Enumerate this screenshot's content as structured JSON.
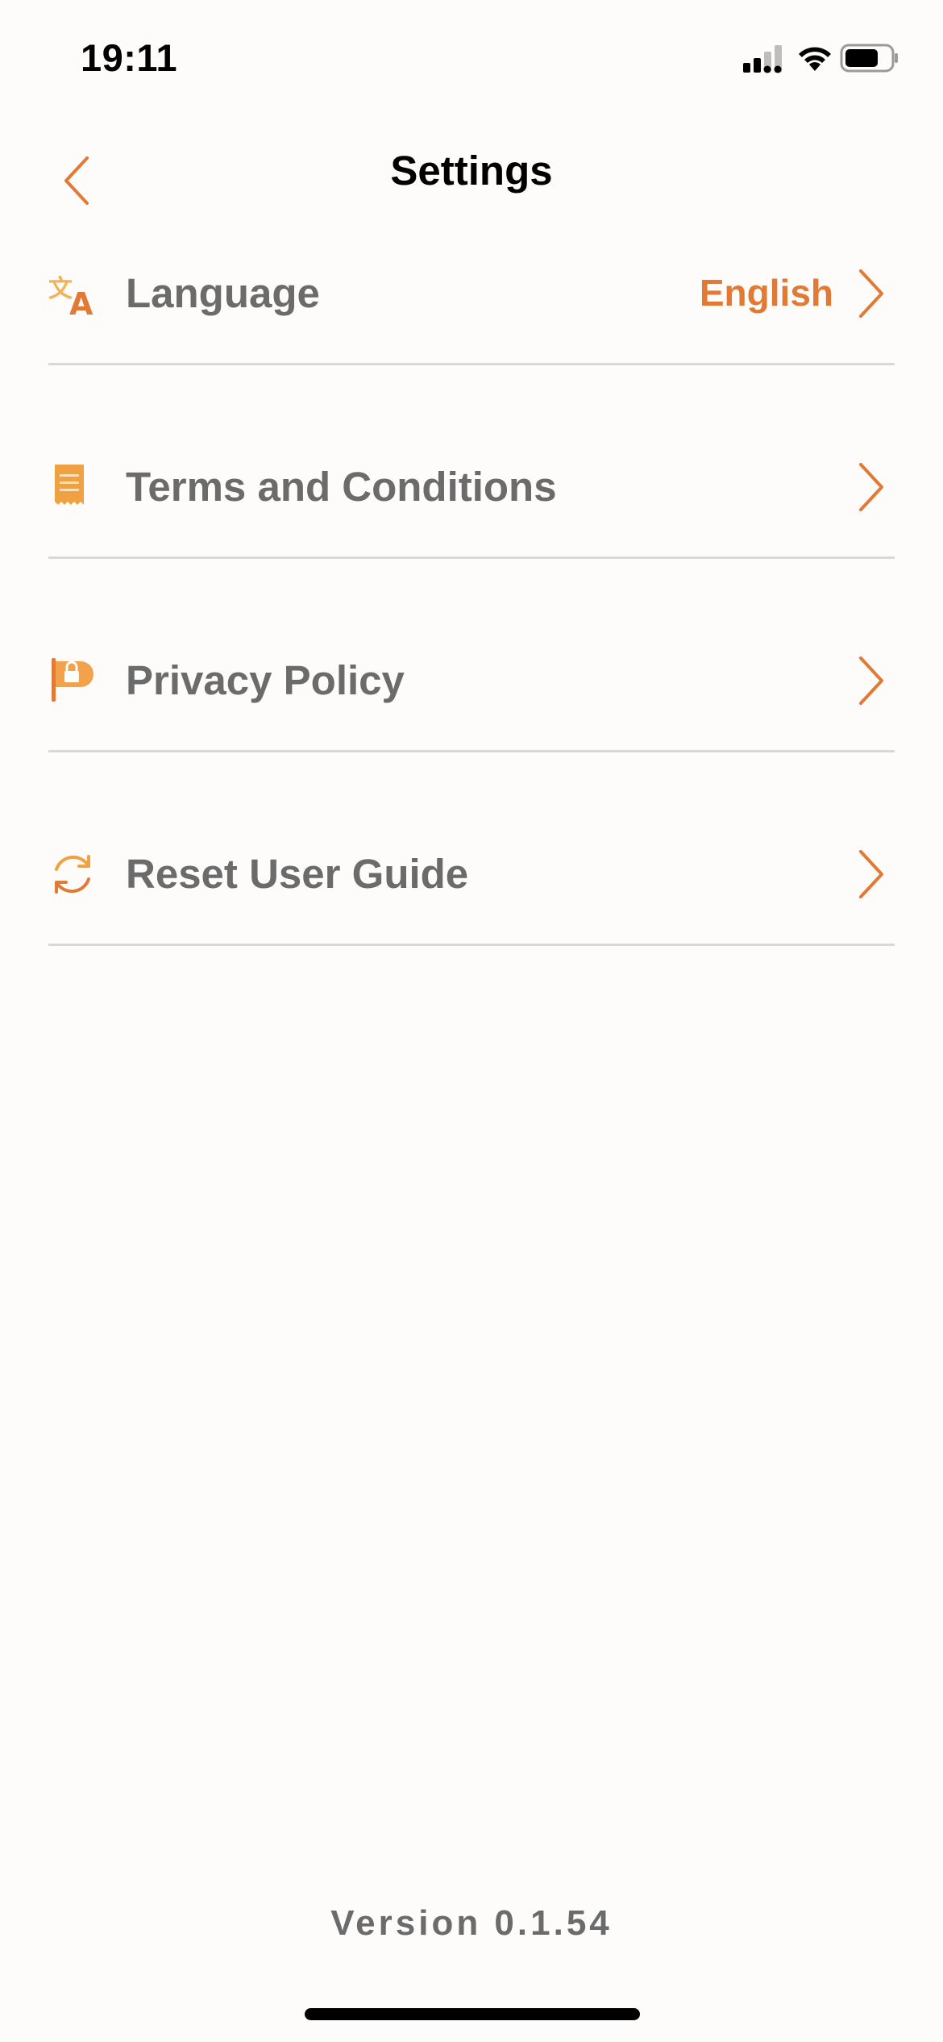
{
  "status_bar": {
    "time": "19:11",
    "icons": [
      "cellular-signal-icon",
      "wifi-icon",
      "battery-icon"
    ]
  },
  "header": {
    "title": "Settings",
    "back_icon": "chevron-left-icon"
  },
  "settings": {
    "items": [
      {
        "label": "Language",
        "value": "English",
        "icon": "translate-icon"
      },
      {
        "label": "Terms and Conditions",
        "icon": "document-icon"
      },
      {
        "label": "Privacy Policy",
        "icon": "privacy-flag-icon"
      },
      {
        "label": "Reset User Guide",
        "icon": "refresh-icon"
      }
    ]
  },
  "footer": {
    "version": "Version 0.1.54"
  },
  "colors": {
    "accent": "#e07a35",
    "text": "#6b6b6b",
    "divider": "#d8d8d8",
    "background": "#fdfcfb"
  }
}
